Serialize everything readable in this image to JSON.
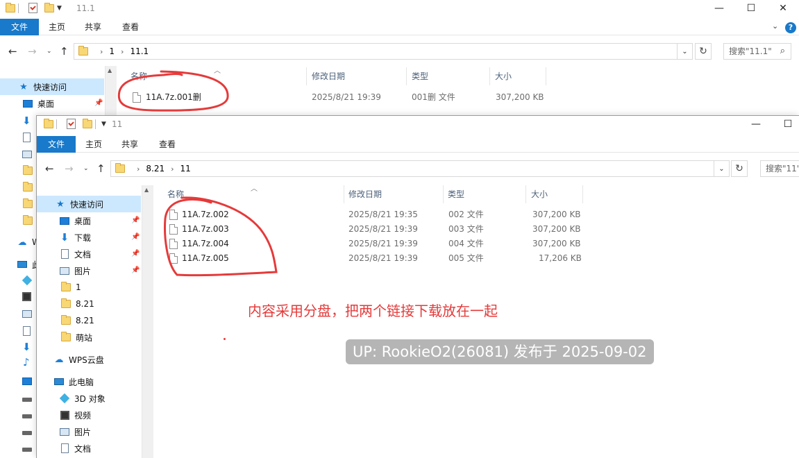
{
  "back_window": {
    "title": "11.1",
    "ribbon_tabs": [
      "文件",
      "主页",
      "共享",
      "查看"
    ],
    "path": [
      "1",
      "11.1"
    ],
    "search_placeholder": "搜索\"11.1\"",
    "columns": [
      "名称",
      "修改日期",
      "类型",
      "大小"
    ],
    "files": [
      {
        "name": "11A.7z.001删",
        "date": "2025/8/21 19:39",
        "type": "001删 文件",
        "size": "307,200 KB"
      }
    ],
    "nav": {
      "quick_access": "快速访问",
      "desktop": "桌面",
      "wps_cloud_partial": "W",
      "this_pc_partial": "此"
    }
  },
  "front_window": {
    "title": "11",
    "ribbon_tabs": [
      "文件",
      "主页",
      "共享",
      "查看"
    ],
    "path": [
      "8.21",
      "11"
    ],
    "search_placeholder": "搜索\"11\"",
    "columns": [
      "名称",
      "修改日期",
      "类型",
      "大小"
    ],
    "files": [
      {
        "name": "11A.7z.002",
        "date": "2025/8/21 19:35",
        "type": "002 文件",
        "size": "307,200 KB"
      },
      {
        "name": "11A.7z.003",
        "date": "2025/8/21 19:39",
        "type": "003 文件",
        "size": "307,200 KB"
      },
      {
        "name": "11A.7z.004",
        "date": "2025/8/21 19:39",
        "type": "004 文件",
        "size": "307,200 KB"
      },
      {
        "name": "11A.7z.005",
        "date": "2025/8/21 19:39",
        "type": "005 文件",
        "size": "17,206 KB"
      }
    ],
    "nav": {
      "quick_access": "快速访问",
      "desktop": "桌面",
      "downloads": "下载",
      "documents": "文档",
      "pictures": "图片",
      "folder_1": "1",
      "folder_821a": "8.21",
      "folder_821b": "8.21",
      "folder_mengzhan": "萌站",
      "wps_cloud": "WPS云盘",
      "this_pc": "此电脑",
      "objects_3d": "3D 对象",
      "videos": "视频",
      "pc_pictures": "图片",
      "pc_documents": "文档"
    }
  },
  "annotation": "内容采用分盘，把两个链接下载放在一起",
  "watermark": "UP: RookieO2(26081) 发布于 2025-09-02",
  "colors": {
    "accent": "#1979ca",
    "annotation_red": "#e53a3a",
    "selection": "#cce8ff"
  }
}
